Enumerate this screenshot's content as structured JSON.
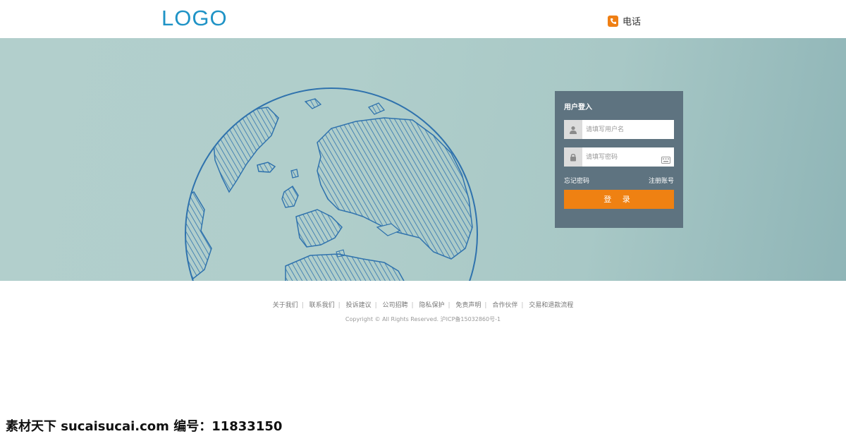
{
  "header": {
    "logo": "LOGO",
    "phone_label": "电话"
  },
  "login": {
    "title": "用户登入",
    "username_placeholder": "请填写用户名",
    "password_placeholder": "请填写密码",
    "forgot_password": "忘记密码",
    "register": "注册账号",
    "submit": "登 录"
  },
  "footer": {
    "links": [
      "关于我们",
      "联系我们",
      "投诉建议",
      "公司招聘",
      "隐私保护",
      "免责声明",
      "合作伙伴",
      "交易和退款流程"
    ],
    "copyright": "Copyright © All Rights Reserved. 沪ICP备15032860号-1"
  },
  "watermark": "素材天下 sucaisucai.com  编号：11833150",
  "colors": {
    "logo": "#1f93c6",
    "accent": "#ef8112",
    "panel": "#5e7380",
    "globe_stroke": "#2f72ad"
  }
}
